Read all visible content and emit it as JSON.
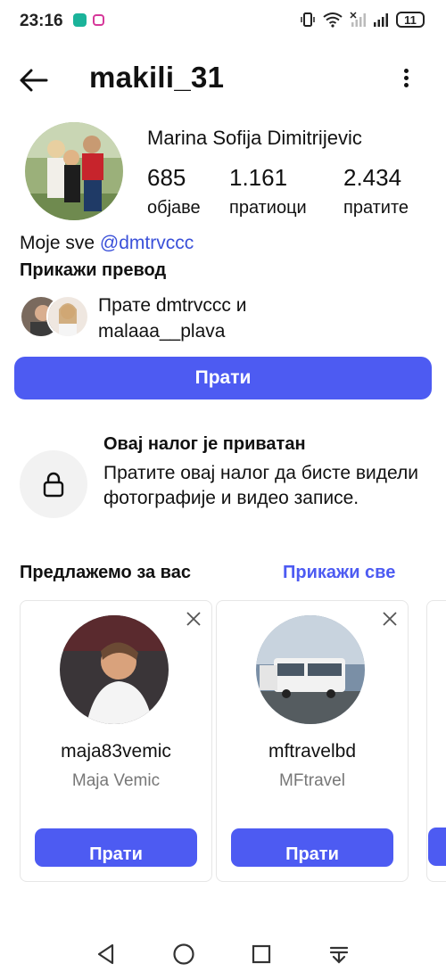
{
  "status_bar": {
    "time": "23:16",
    "battery": "11"
  },
  "header": {
    "username": "makili_31"
  },
  "profile": {
    "full_name": "Marina Sofija Dimitrijevic",
    "stats": [
      {
        "value": "685",
        "label": "објаве"
      },
      {
        "value": "1.161",
        "label": "пратиоци"
      },
      {
        "value": "2.434",
        "label": "пратите"
      }
    ],
    "bio_text": "Moje sve ",
    "bio_link": "@dmtrvccc",
    "translate": "Прикажи превод",
    "mutual_line1": "Прате dmtrvccc и",
    "mutual_line2": "malaaa__plava",
    "follow_button": "Прати"
  },
  "private": {
    "title": "Овај налог је приватан",
    "text": "Пратите овај налог да бисте видели фотографије и видео записе."
  },
  "suggestions": {
    "title": "Предлажемо за вас",
    "see_all": "Прикажи све",
    "cards": [
      {
        "username": "maja83vemic",
        "name": "Maja Vemic",
        "button": "Прати"
      },
      {
        "username": "mftravelbd",
        "name": "MFtravel",
        "button": "Прати"
      }
    ]
  },
  "colors": {
    "accent": "#4d5bf2",
    "link": "#3a50d9"
  }
}
